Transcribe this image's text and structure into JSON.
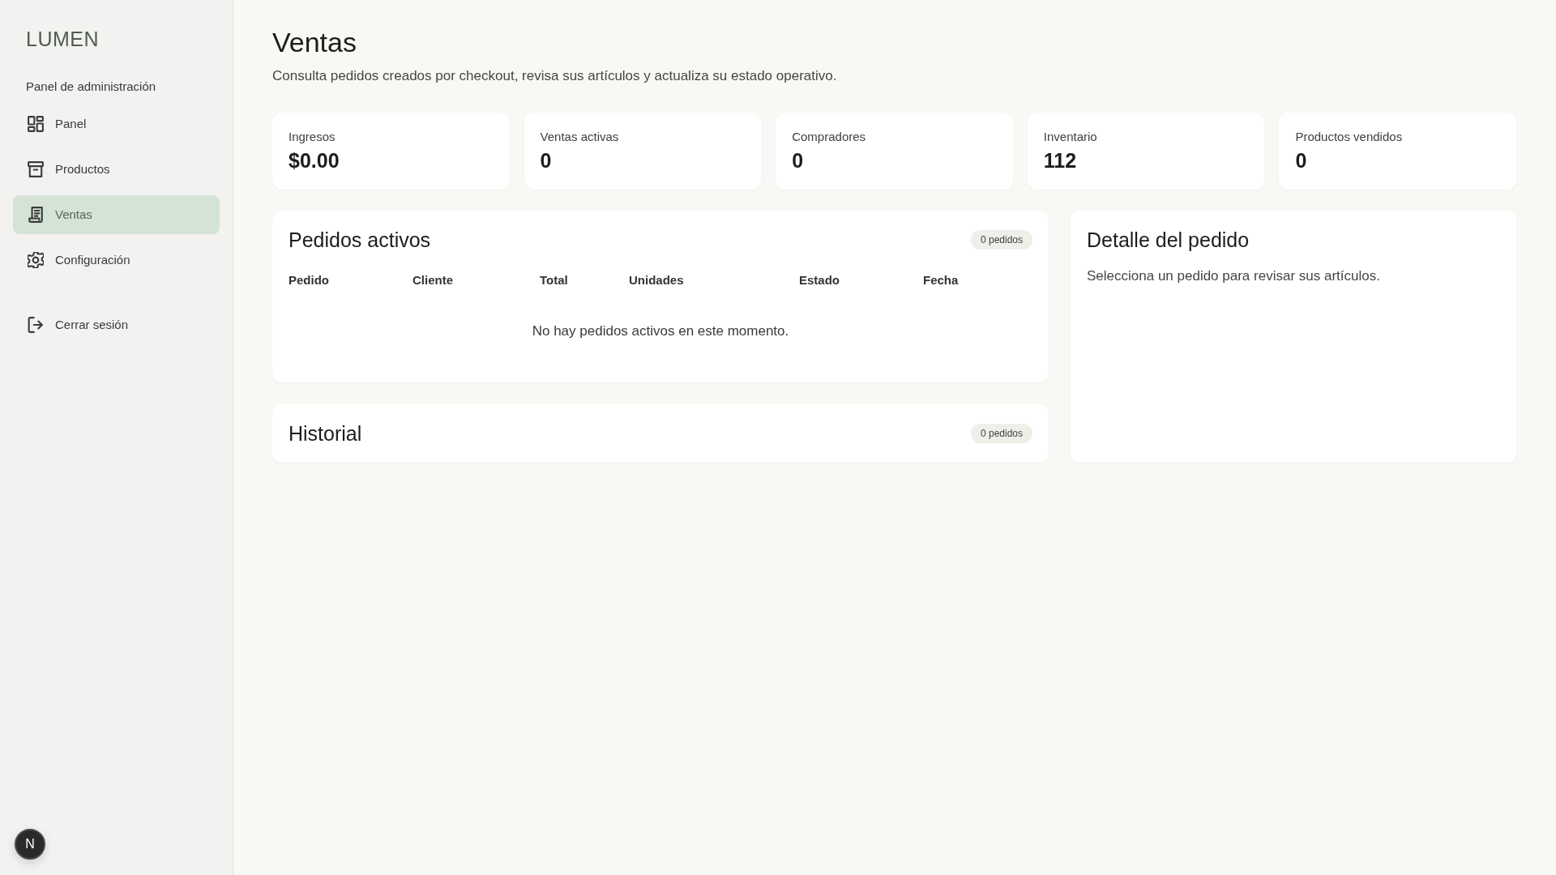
{
  "sidebar": {
    "brand": "LUMEN",
    "section_label": "Panel de administración",
    "items": [
      {
        "label": "Panel",
        "selected": false
      },
      {
        "label": "Productos",
        "selected": false
      },
      {
        "label": "Ventas",
        "selected": true
      },
      {
        "label": "Configuración",
        "selected": false
      }
    ],
    "logout": {
      "label": "Cerrar sesión"
    }
  },
  "dev_badge": {
    "label": "N"
  },
  "header": {
    "title": "Ventas",
    "subtitle": "Consulta pedidos creados por checkout, revisa sus artículos y actualiza su estado operativo."
  },
  "stats": [
    {
      "label": "Ingresos",
      "value": "$0.00"
    },
    {
      "label": "Ventas activas",
      "value": "0"
    },
    {
      "label": "Compradores",
      "value": "0"
    },
    {
      "label": "Inventario",
      "value": "112"
    },
    {
      "label": "Productos vendidos",
      "value": "0"
    }
  ],
  "active_orders": {
    "title": "Pedidos activos",
    "count": "0 pedidos",
    "columns": [
      "Pedido",
      "Cliente",
      "Total",
      "Unidades",
      "Estado",
      "Fecha"
    ],
    "empty_message": "No hay pedidos activos en este momento."
  },
  "history": {
    "title": "Historial",
    "count": "0 pedidos"
  },
  "order_detail": {
    "title": "Detalle del pedido",
    "message": "Selecciona un pedido para revisar sus artículos."
  }
}
